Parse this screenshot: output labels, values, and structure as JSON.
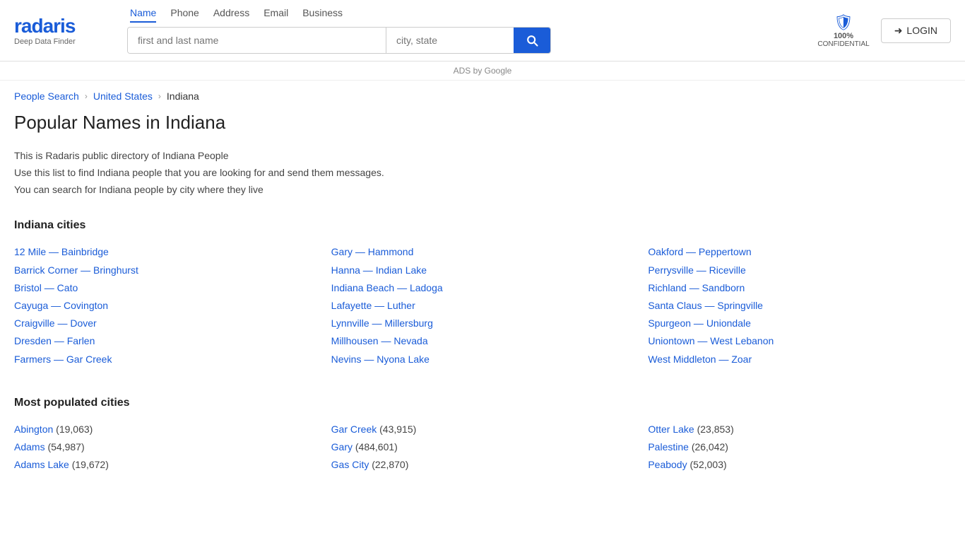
{
  "logo": {
    "text": "radaris",
    "tagline": "Deep Data Finder"
  },
  "nav": {
    "tabs": [
      {
        "label": "Name",
        "active": true
      },
      {
        "label": "Phone",
        "active": false
      },
      {
        "label": "Address",
        "active": false
      },
      {
        "label": "Email",
        "active": false
      },
      {
        "label": "Business",
        "active": false
      }
    ]
  },
  "search": {
    "name_placeholder": "first and last name",
    "city_placeholder": "city, state"
  },
  "confidential": {
    "percent": "100%",
    "label": "CONFIDENTIAL"
  },
  "login": {
    "label": "LOGIN"
  },
  "ads": {
    "label": "ADS by Google"
  },
  "breadcrumb": {
    "items": [
      {
        "label": "People Search",
        "href": "#"
      },
      {
        "label": "United States",
        "href": "#"
      },
      {
        "label": "Indiana",
        "href": null
      }
    ]
  },
  "page": {
    "title": "Popular Names in Indiana",
    "description_lines": [
      "This is Radaris public directory of Indiana People",
      "Use this list to find Indiana people that you are looking for and send them messages.",
      "You can search for Indiana people by city where they live"
    ]
  },
  "indiana_cities": {
    "section_title": "Indiana cities",
    "links_col1": [
      {
        "label": "12 Mile — Bainbridge",
        "href": "#"
      },
      {
        "label": "Barrick Corner — Bringhurst",
        "href": "#"
      },
      {
        "label": "Bristol — Cato",
        "href": "#"
      },
      {
        "label": "Cayuga — Covington",
        "href": "#"
      },
      {
        "label": "Craigville — Dover",
        "href": "#"
      },
      {
        "label": "Dresden — Farlen",
        "href": "#"
      },
      {
        "label": "Farmers — Gar Creek",
        "href": "#"
      }
    ],
    "links_col2": [
      {
        "label": "Gary — Hammond",
        "href": "#"
      },
      {
        "label": "Hanna — Indian Lake",
        "href": "#"
      },
      {
        "label": "Indiana Beach — Ladoga",
        "href": "#"
      },
      {
        "label": "Lafayette — Luther",
        "href": "#"
      },
      {
        "label": "Lynnville — Millersburg",
        "href": "#"
      },
      {
        "label": "Millhousen — Nevada",
        "href": "#"
      },
      {
        "label": "Nevins — Nyona Lake",
        "href": "#"
      }
    ],
    "links_col3": [
      {
        "label": "Oakford — Peppertown",
        "href": "#"
      },
      {
        "label": "Perrysville — Riceville",
        "href": "#"
      },
      {
        "label": "Richland — Sandborn",
        "href": "#"
      },
      {
        "label": "Santa Claus — Springville",
        "href": "#"
      },
      {
        "label": "Spurgeon — Uniondale",
        "href": "#"
      },
      {
        "label": "Uniontown — West Lebanon",
        "href": "#"
      },
      {
        "label": "West Middleton — Zoar",
        "href": "#"
      }
    ]
  },
  "most_populated": {
    "section_title": "Most populated cities",
    "cities_col1": [
      {
        "label": "Abington",
        "count": "(19,063)"
      },
      {
        "label": "Adams",
        "count": "(54,987)"
      },
      {
        "label": "Adams Lake",
        "count": "(19,672)"
      }
    ],
    "cities_col2": [
      {
        "label": "Gar Creek",
        "count": "(43,915)"
      },
      {
        "label": "Gary",
        "count": "(484,601)"
      },
      {
        "label": "Gas City",
        "count": "(22,870)"
      }
    ],
    "cities_col3": [
      {
        "label": "Otter Lake",
        "count": "(23,853)"
      },
      {
        "label": "Palestine",
        "count": "(26,042)"
      },
      {
        "label": "Peabody",
        "count": "(52,003)"
      }
    ]
  }
}
